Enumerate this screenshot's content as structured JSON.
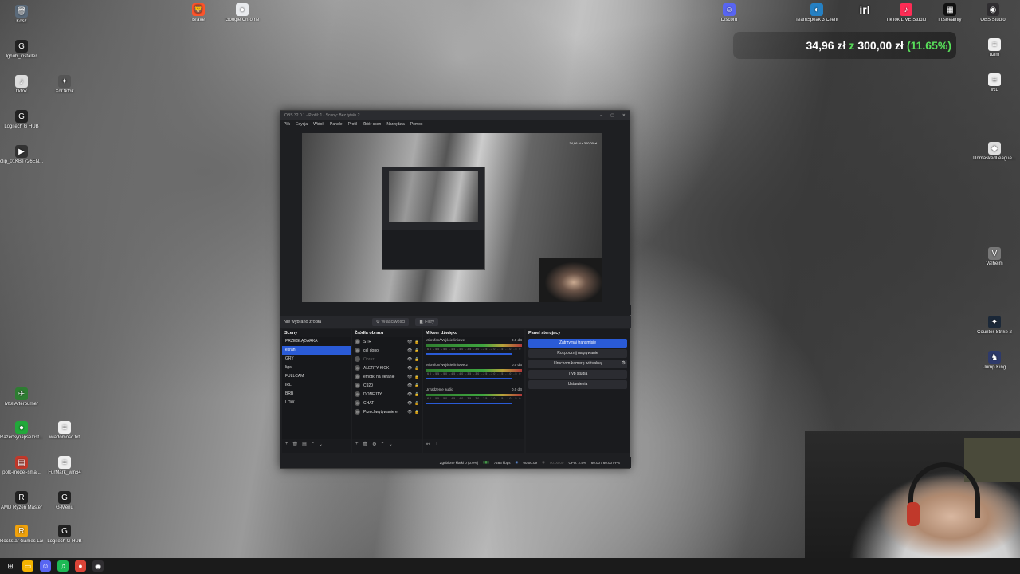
{
  "desktop": {
    "left_icons": [
      {
        "label": "Kosz",
        "glyph": "🗑",
        "color": "#5a6a7a",
        "icon": "recycle-bin-icon"
      },
      {
        "label": "lghub_installer",
        "glyph": "G",
        "color": "#222",
        "icon": "logitech-icon"
      },
      {
        "label": "tiktok",
        "glyph": "♪",
        "color": "#ddd",
        "icon": "file-icon"
      },
      {
        "label": "Logitech G HUB",
        "glyph": "G",
        "color": "#222",
        "icon": "logitech-icon"
      },
      {
        "label": "clip_01KBT726EN...",
        "glyph": "▶",
        "color": "#333",
        "icon": "video-file-icon"
      },
      {
        "label": "MSI Afterburner",
        "glyph": "✈",
        "color": "#2e7d32",
        "icon": "afterburner-icon"
      },
      {
        "label": "RazerSynapseInst...",
        "glyph": "●",
        "color": "#22a83a",
        "icon": "razer-icon"
      },
      {
        "label": "polk-model-sma...",
        "glyph": "▤",
        "color": "#c0392b",
        "icon": "archive-icon"
      },
      {
        "label": "AMD Ryzen Master",
        "glyph": "R",
        "color": "#222",
        "icon": "amd-icon"
      },
      {
        "label": "Rockstar Games Launcher",
        "glyph": "R",
        "color": "#f1a20b",
        "icon": "rockstar-icon"
      }
    ],
    "second_col_icons": [
      {
        "label": "XdOktok",
        "glyph": "✦",
        "color": "#555",
        "icon": "shortcut-icon"
      },
      {
        "label": "wiadomosc.txt",
        "glyph": "≡",
        "color": "#eee",
        "icon": "text-file-icon"
      },
      {
        "label": "FurMark_win64",
        "glyph": "≡",
        "color": "#eee",
        "icon": "file-icon"
      },
      {
        "label": "G-Menu",
        "glyph": "G",
        "color": "#222",
        "icon": "logitech-icon"
      },
      {
        "label": "Logitech G HUB",
        "glyph": "G",
        "color": "#222",
        "icon": "logitech-icon"
      }
    ],
    "top_icons": [
      {
        "label": "Brave",
        "glyph": "🦁",
        "color": "#fb542b",
        "icon": "brave-icon"
      },
      {
        "label": "Google Chrome",
        "glyph": "●",
        "color": "#e8eaed",
        "icon": "chrome-icon"
      }
    ],
    "top_right_icons": [
      {
        "label": "Discord",
        "glyph": "☺",
        "color": "#5865f2",
        "icon": "discord-icon"
      },
      {
        "label": "TeamSpeak 3 Client",
        "glyph": "◐",
        "color": "#2580c3",
        "icon": "teamspeak-icon"
      },
      {
        "label": "",
        "glyph": "irl",
        "color": "transparent",
        "icon": "irl-logo-icon"
      },
      {
        "label": "TikTok LIVE Studio",
        "glyph": "♪",
        "color": "#fe2c55",
        "icon": "tiktok-icon"
      },
      {
        "label": "in.streamly",
        "glyph": "▦",
        "color": "#111",
        "icon": "streamly-icon"
      },
      {
        "label": "OBS Studio",
        "glyph": "◉",
        "color": "#302e31",
        "icon": "obs-icon"
      }
    ],
    "right_icons": [
      {
        "label": "Snip",
        "glyph": "≡",
        "color": "#eee",
        "icon": "file-icon"
      },
      {
        "label": "uzim",
        "glyph": "≡",
        "color": "#eee",
        "icon": "file-icon"
      },
      {
        "label": "IRL",
        "glyph": "≡",
        "color": "#eee",
        "icon": "file-icon"
      },
      {
        "label": "UnmaskedLeague...",
        "glyph": "◆",
        "color": "#ddd",
        "icon": "app-icon"
      },
      {
        "label": "Valheim",
        "glyph": "V",
        "color": "#777",
        "icon": "valheim-icon"
      },
      {
        "label": "Counter-Strike 2",
        "glyph": "✦",
        "color": "#1b2838",
        "icon": "cs2-icon"
      },
      {
        "label": "Jump King",
        "glyph": "♞",
        "color": "#2e3a6b",
        "icon": "jumpking-icon"
      }
    ]
  },
  "goal": {
    "current": "34,96 zł",
    "sep": "z",
    "target": "300,00 zł",
    "percent": "(11.65%)"
  },
  "obs": {
    "title": "OBS 32.0.1 - Profil: 1 - Sceny: Bez tytułu 2",
    "menu": [
      "Plik",
      "Edycja",
      "Widok",
      "Panele",
      "Profil",
      "Zbiór scen",
      "Narzędzia",
      "Pomoc"
    ],
    "no_source": "Nie wybrano źródła",
    "properties_btn": "Właściwości",
    "filters_btn": "Filtry",
    "scenes_title": "Sceny",
    "scenes": [
      "PRZEGLĄDARKA",
      "ekran",
      "GRY",
      "liga",
      "FULLCAM",
      "IRL",
      "BRB",
      "LOW"
    ],
    "active_scene_index": 1,
    "sources_title": "Źródła obrazu",
    "sources": [
      {
        "name": "STR",
        "dim": false
      },
      {
        "name": "cel dono",
        "dim": false
      },
      {
        "name": "Obraz",
        "dim": true
      },
      {
        "name": "ALERTY KICK",
        "dim": false
      },
      {
        "name": "emotki na ekranie",
        "dim": false
      },
      {
        "name": "C920",
        "dim": false
      },
      {
        "name": "DONEJTY",
        "dim": false
      },
      {
        "name": "CHAT",
        "dim": false
      },
      {
        "name": "Przechwytywanie e",
        "dim": false
      }
    ],
    "mixer_title": "Mikser dźwięku",
    "mixer": [
      {
        "name": "Mikrofon/Wejście liniowe",
        "db": "0.0 dB"
      },
      {
        "name": "Mikrofon/Wejście liniowe 2",
        "db": "0.0 dB"
      },
      {
        "name": "Urządzenie audio",
        "db": "0.0 dB"
      }
    ],
    "mixer_scale": "-60 -55 -50 -45 -40 -35 -30 -25 -20 -15 -10 -5 0",
    "controls_title": "Panel sterujący",
    "controls": {
      "start_stream": "Zatrzymaj transmisję",
      "start_record": "Rozpocznij nagrywanie",
      "virtual_cam": "Uruchom kamerę wirtualną",
      "studio_mode": "Tryb studia",
      "settings": "Ustawienia"
    },
    "status": {
      "dropped": "Zgubione klatki 0 (0.0%)",
      "bitrate": "7286 kbps",
      "stream_time": "00:00:09",
      "rec_time": "00:00:00",
      "cpu": "CPU: 2.4%",
      "fps": "60.00 / 60.00 FPS"
    }
  },
  "taskbar": {
    "icons": [
      {
        "name": "start-icon",
        "glyph": "⊞",
        "color": "transparent"
      },
      {
        "name": "file-explorer-icon",
        "glyph": "▭",
        "color": "#f4b400"
      },
      {
        "name": "discord-taskbar-icon",
        "glyph": "☺",
        "color": "#5865f2"
      },
      {
        "name": "spotify-icon",
        "glyph": "♫",
        "color": "#1db954"
      },
      {
        "name": "chrome-taskbar-icon",
        "glyph": "●",
        "color": "#db4437"
      },
      {
        "name": "obs-taskbar-icon",
        "glyph": "◉",
        "color": "#302e31"
      }
    ]
  }
}
